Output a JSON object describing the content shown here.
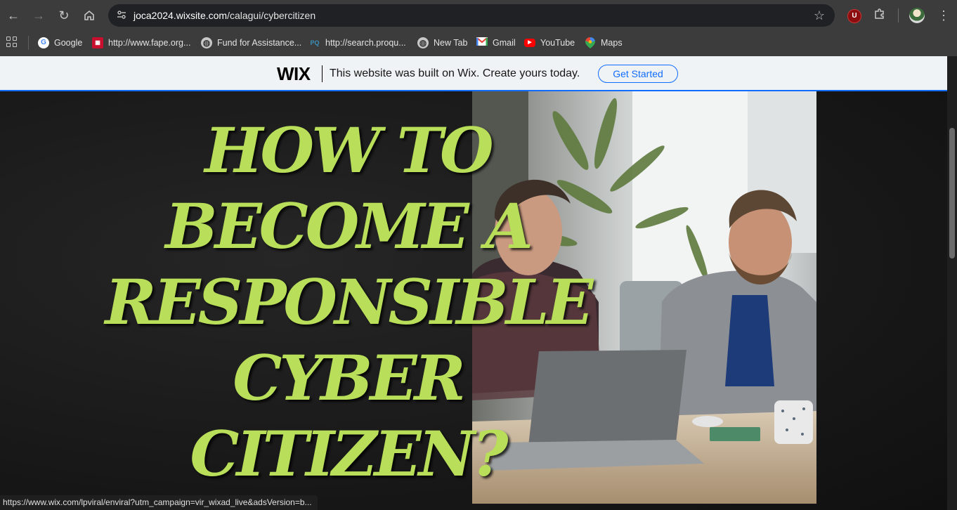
{
  "browser": {
    "url_host": "joca2024.wixsite.com",
    "url_path": "/calagui/cybercitizen",
    "extension_badge": "U",
    "bookmarks": [
      {
        "label": "Google",
        "icon": "google-icon"
      },
      {
        "label": "http://www.fape.org...",
        "icon": "fape-icon"
      },
      {
        "label": "Fund for Assistance...",
        "icon": "globe-icon"
      },
      {
        "label": "http://search.proqu...",
        "icon": "proquest-icon"
      },
      {
        "label": "New Tab",
        "icon": "globe-icon"
      },
      {
        "label": "Gmail",
        "icon": "gmail-icon"
      },
      {
        "label": "YouTube",
        "icon": "youtube-icon"
      },
      {
        "label": "Maps",
        "icon": "maps-icon"
      }
    ],
    "status_url": "https://www.wix.com/lpviral/enviral?utm_campaign=vir_wixad_live&adsVersion=b..."
  },
  "wix_banner": {
    "logo": "WIX",
    "message": "This website was built on Wix. Create yours today.",
    "cta": "Get Started"
  },
  "hero": {
    "line1": "HOW TO",
    "line2": "BECOME A",
    "line3": "RESPONSIBLE",
    "line4": "CYBER",
    "line5": "CITIZEN?",
    "photo_description_icon": "photo-two-men-laptop"
  },
  "colors": {
    "heading": "#b8de5a",
    "wix_accent": "#116dff",
    "chrome": "#3c3c3c"
  }
}
